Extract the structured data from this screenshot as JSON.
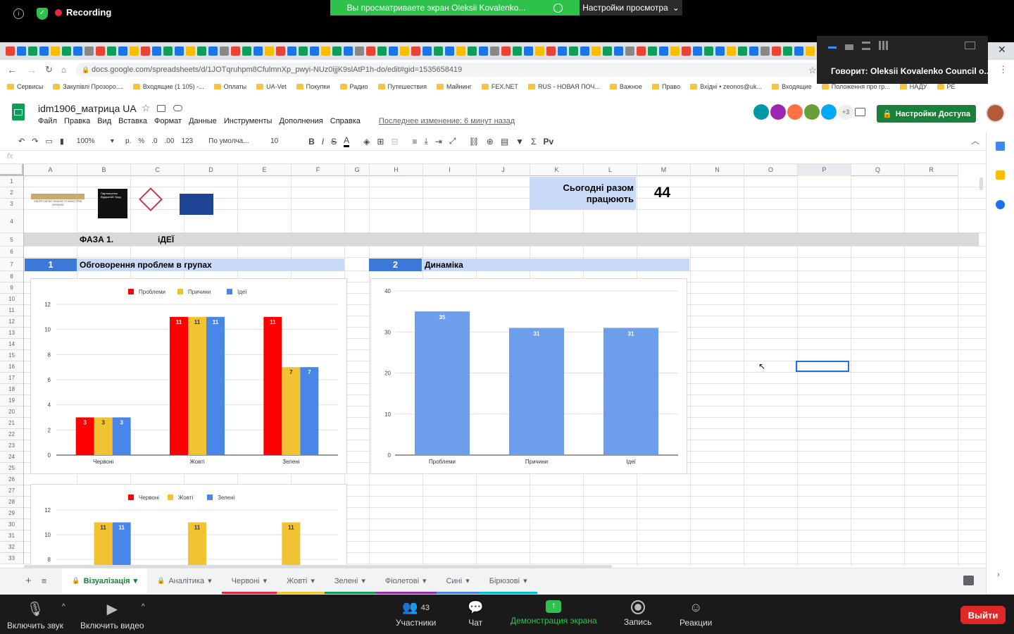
{
  "zoom": {
    "recording": "Recording",
    "banner": "Вы просматриваете экран Oleksii Kovalenko...",
    "view_options": "Настройки просмотра",
    "speaker": "Говорит: Oleksii Kovalenko Council o...",
    "bottom": {
      "mute": "Включить звук",
      "video": "Включить видео",
      "participants": "Участники",
      "participants_count": "43",
      "chat": "Чат",
      "share": "Демонстрация экрана",
      "record": "Запись",
      "reactions": "Реакции",
      "exit": "Выйти"
    }
  },
  "browser": {
    "url": "docs.google.com/spreadsheets/d/1JOTqruhpm8CfulmnXp_pwyi-NUz0ijjK9slAtP1h-do/edit#gid=1535658419",
    "bookmarks": [
      "Сервисы",
      "Закупівлі Прозоро....",
      "Входящие (1 105) -...",
      "Оплаты",
      "UA-Vet",
      "Покупки",
      "Радио",
      "Путешествия",
      "Майнинг",
      "FEX.NET",
      "RUS - НОВАЯ ПОЧ...",
      "Важное",
      "Право",
      "Вхідні • zeonos@uk...",
      "Входящие",
      "Положення про гр...",
      "НАДУ",
      "PE"
    ]
  },
  "sheets": {
    "title": "idm1906_матрица UA",
    "menus": [
      "Файл",
      "Правка",
      "Вид",
      "Вставка",
      "Формат",
      "Данные",
      "Инструменты",
      "Дополнения",
      "Справка"
    ],
    "last_edit": "Последнее изменение: 6 минут назад",
    "share": "Настройки Доступа",
    "avatars_more": "+3",
    "toolbar": {
      "zoom": "100%",
      "currency": "р.",
      "percent": "%",
      "dec0": ".0",
      "dec00": ".00",
      "format": "123",
      "font": "По умолча...",
      "size": "10"
    },
    "columns": [
      "A",
      "B",
      "C",
      "D",
      "E",
      "F",
      "G",
      "H",
      "I",
      "J",
      "K",
      "L",
      "M",
      "N",
      "O",
      "P",
      "Q",
      "R"
    ],
    "rows": [
      "1",
      "2",
      "3",
      "4",
      "5",
      "6",
      "7",
      "8",
      "9",
      "10",
      "11",
      "12",
      "13",
      "14",
      "15",
      "16",
      "17",
      "18",
      "19",
      "20",
      "21",
      "22",
      "23",
      "24",
      "25",
      "26",
      "27",
      "28",
      "29",
      "30",
      "31",
      "32",
      "33"
    ],
    "cells": {
      "today_label_1": "Сьогодні разом",
      "today_label_2": "працюють",
      "today_value": "44",
      "phase": "ФАЗА 1.",
      "ideas": "іДЕЇ",
      "sec1_num": "1",
      "sec1_title": "Обговорення проблем в групах",
      "sec2_num": "2",
      "sec2_title": "Динаміка"
    },
    "tabs": [
      "Візуалізація",
      "Аналітика",
      "Червоні",
      "Жовті",
      "Зелені",
      "Фіолетові",
      "Сині",
      "Бірюзові"
    ]
  },
  "colors": {
    "red": "#ff0000",
    "yellow": "#f1c232",
    "blue": "#4a86e8",
    "lightblue": "#6d9eeb",
    "header_blue": "#c9daf8",
    "dark_blue": "#3c78d8"
  },
  "chart_data": [
    {
      "type": "bar",
      "categories": [
        "Червоні",
        "Жовті",
        "Зелені"
      ],
      "series": [
        {
          "name": "Проблеми",
          "values": [
            3,
            11,
            11
          ]
        },
        {
          "name": "Причини",
          "values": [
            3,
            11,
            7
          ]
        },
        {
          "name": "Ідеї",
          "values": [
            3,
            11,
            7
          ]
        }
      ],
      "ylim": [
        0,
        12
      ],
      "yticks": [
        0,
        2,
        4,
        6,
        8,
        10,
        12
      ],
      "legend": "top"
    },
    {
      "type": "bar",
      "categories": [
        "Проблеми",
        "Причини",
        "Ідеї"
      ],
      "values": [
        35,
        31,
        31
      ],
      "ylim": [
        0,
        40
      ],
      "yticks": [
        0,
        10,
        20,
        30,
        40
      ]
    },
    {
      "type": "bar",
      "series": [
        {
          "name": "Червоні"
        },
        {
          "name": "Жовті",
          "values": [
            11,
            11,
            11
          ]
        },
        {
          "name": "Зелені",
          "values": [
            11
          ]
        }
      ],
      "yticks": [
        8,
        10,
        12
      ],
      "legend": "top"
    }
  ]
}
